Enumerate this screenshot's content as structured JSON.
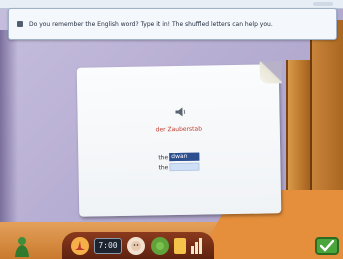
{
  "instruction": {
    "text": "Do you remember the English word? Type it in! The shuffled letters can help you."
  },
  "card": {
    "prompt_word": "der Zauberstab",
    "rows": [
      {
        "article": "the",
        "value": "dwan"
      },
      {
        "article": "the",
        "value": ""
      }
    ],
    "colors": {
      "prompt": "#c0392b",
      "input_empty": "#cfe0f6",
      "input_filled": "#2d4f8f"
    }
  },
  "toolbar": {
    "clock": "7:00"
  },
  "icons": {
    "instruction": "info-bullet-icon",
    "speaker": "speaker-icon",
    "figure": "green-figure-icon",
    "hat": "witch-hat-icon",
    "face": "face-icon",
    "green": "green-ball-icon",
    "book": "book-icon",
    "bars": "stats-bars-icon",
    "check": "check-icon"
  }
}
